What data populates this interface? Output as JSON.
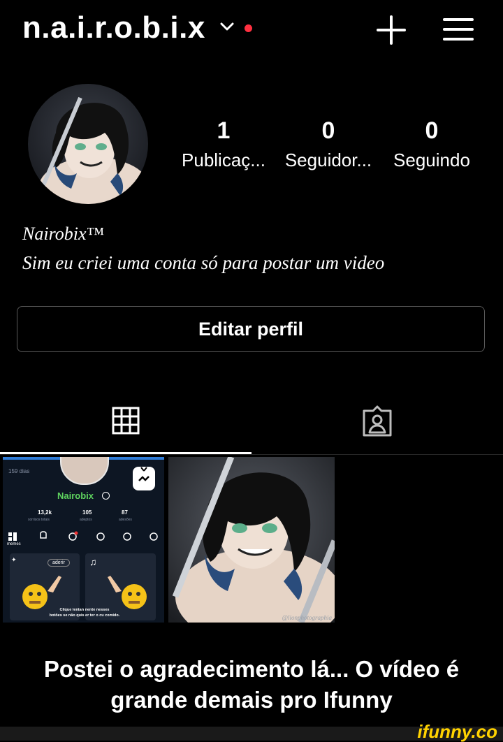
{
  "header": {
    "username": "n.a.i.r.o.b.i.x",
    "icons": [
      "chevron-down-icon",
      "notification-dot",
      "plus-icon",
      "menu-icon"
    ],
    "accent_red": "#ff3040"
  },
  "profile": {
    "stats": [
      {
        "value": "1",
        "label": "Publicaç..."
      },
      {
        "value": "0",
        "label": "Seguidor..."
      },
      {
        "value": "0",
        "label": "Seguindo"
      }
    ],
    "bio_name": "Nairobix™",
    "bio_text": "Sim eu criei uma conta só para postar um video",
    "edit_button": "Editar perfil"
  },
  "tabs": {
    "items": [
      "grid-icon",
      "tagged-icon"
    ],
    "active": "grid-icon"
  },
  "posts": {
    "post1": {
      "days": "159 dias",
      "name": "Nairobix",
      "stats": [
        {
          "value": "13,2k",
          "label": "sorrisos totais"
        },
        {
          "value": "105",
          "label": "adeptos"
        },
        {
          "value": "87",
          "label": "adesões"
        }
      ],
      "memes": "memes",
      "join": "aderir",
      "line1": "Clique lentan  nente nesses",
      "line2": "botões se não quis  er ter o cu comido."
    },
    "post2": {
      "watermark": "@lionphotographia"
    }
  },
  "caption": {
    "line1": "Postei o agradecimento lá... O vídeo é",
    "line2": "grande demais pro Ifunny"
  },
  "watermark": "ifunny.co"
}
